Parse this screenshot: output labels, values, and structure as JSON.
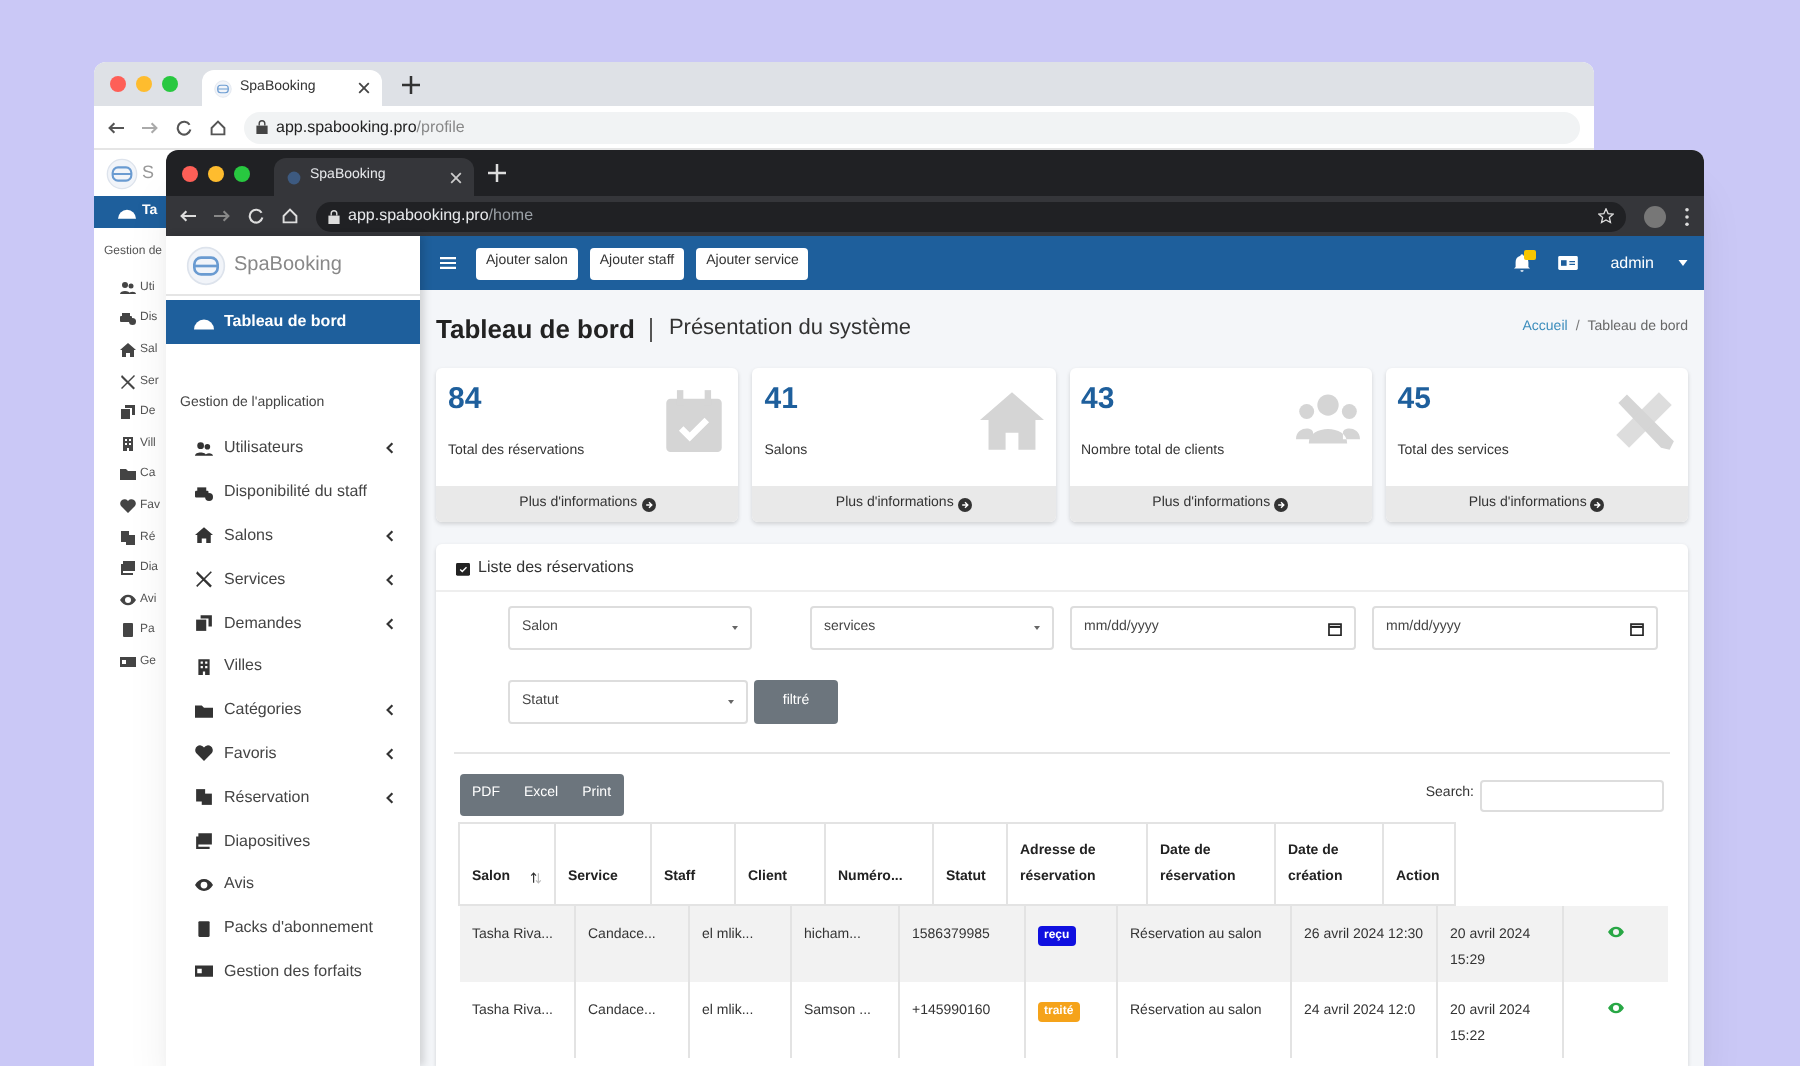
{
  "background_window": {
    "tab_title": "SpaBooking",
    "url_host": "app.spabooking.pro",
    "url_path": "/profile",
    "logo_text": "S",
    "active_item": "Ta",
    "section": "Gestion de",
    "sidebar_items": [
      "Uti",
      "Dis",
      "Sal",
      "Ser",
      "De",
      "Vill",
      "Ca",
      "Fav",
      "Ré",
      "Dia",
      "Avi",
      "Pa",
      "Ge"
    ]
  },
  "browser": {
    "tab_title": "SpaBooking",
    "url_host": "app.spabooking.pro",
    "url_path": "/home"
  },
  "sidebar": {
    "brand": "SpaBooking",
    "active_item": "Tableau de bord",
    "section": "Gestion de l'application",
    "items": [
      {
        "label": "Utilisateurs",
        "expandable": true
      },
      {
        "label": "Disponibilité du staff",
        "expandable": false
      },
      {
        "label": "Salons",
        "expandable": true
      },
      {
        "label": "Services",
        "expandable": true
      },
      {
        "label": "Demandes",
        "expandable": true
      },
      {
        "label": "Villes",
        "expandable": false
      },
      {
        "label": "Catégories",
        "expandable": true
      },
      {
        "label": "Favoris",
        "expandable": true
      },
      {
        "label": "Réservation",
        "expandable": true
      },
      {
        "label": "Diapositives",
        "expandable": false
      },
      {
        "label": "Avis",
        "expandable": false
      },
      {
        "label": "Packs d'abonnement",
        "expandable": false
      },
      {
        "label": "Gestion des forfaits",
        "expandable": false
      }
    ]
  },
  "header": {
    "buttons": [
      "Ajouter salon",
      "Ajouter staff",
      "Ajouter service"
    ],
    "user": "admin"
  },
  "page": {
    "title": "Tableau de bord",
    "subtitle": "Présentation du système",
    "breadcrumb_separator": "/",
    "breadcrumb": [
      {
        "label": "Accueil",
        "link": true
      },
      {
        "label": "Tableau de bord",
        "link": false
      }
    ]
  },
  "stats": [
    {
      "value": "84",
      "label": "Total des réservations",
      "more": "Plus d'informations"
    },
    {
      "value": "41",
      "label": "Salons",
      "more": "Plus d'informations"
    },
    {
      "value": "43",
      "label": "Nombre total de clients",
      "more": "Plus d'informations"
    },
    {
      "value": "45",
      "label": "Total des services",
      "more": "Plus d'informations"
    }
  ],
  "reservations": {
    "title": "Liste des réservations",
    "filters": {
      "salon": "Salon",
      "services": "services",
      "date_from": "mm/dd/yyyy",
      "date_to": "mm/dd/yyyy",
      "status": "Statut",
      "button": "filtré"
    },
    "export_buttons": [
      "PDF",
      "Excel",
      "Print"
    ],
    "search_label": "Search:",
    "columns": [
      "Salon",
      "Service",
      "Staff",
      "Client",
      "Numéro...",
      "Statut",
      "Adresse de réservation",
      "Date de réservation",
      "Date de création",
      "Action"
    ],
    "rows": [
      {
        "salon": "Tasha Riva...",
        "service": "Candace...",
        "staff": "el mlik...",
        "client": "hicham...",
        "number": "1586379985",
        "status": "reçu",
        "color": "#1010e0",
        "address": "Réservation au salon",
        "date": "26 avril 2024 12:30",
        "created": "20 avril 2024 15:29"
      },
      {
        "salon": "Tasha Riva...",
        "service": "Candace...",
        "staff": "el mlik...",
        "client": "Samson ...",
        "number": "+145990160",
        "status": "traité",
        "color": "#f5a31a",
        "address": "Réservation au salon",
        "date": "24 avril 2024 12:0",
        "created": "20 avril 2024 15:22"
      }
    ]
  }
}
